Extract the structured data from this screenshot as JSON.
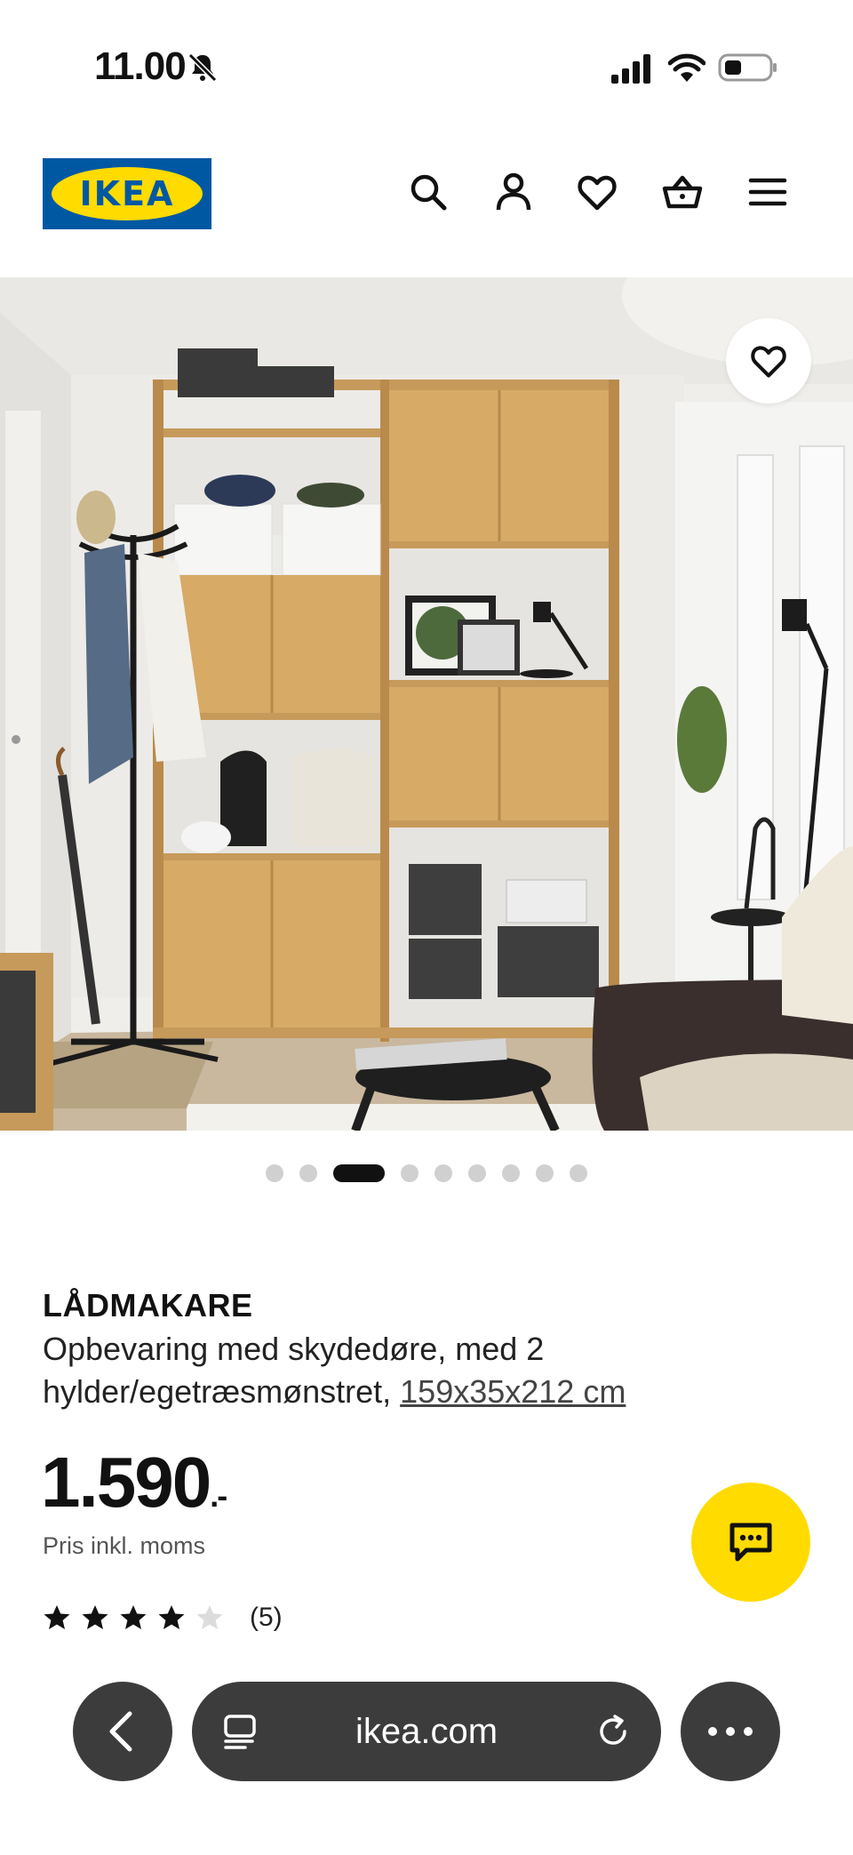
{
  "status_bar": {
    "time": "11.00"
  },
  "header": {
    "logo_text": "IKEA",
    "icons": [
      "search-icon",
      "user-icon",
      "heart-icon",
      "basket-icon",
      "menu-icon"
    ]
  },
  "gallery": {
    "total_images": 9,
    "active_index": 3
  },
  "product": {
    "name": "LÅDMAKARE",
    "description": "Opbevaring med skydedøre, med 2 hylder/egetræsmønstret,",
    "dimensions": "159x35x212 cm",
    "price": "1.590",
    "price_suffix": ".-",
    "price_note": "Pris inkl. moms",
    "rating": 4,
    "rating_max": 5,
    "review_count": "(5)"
  },
  "browser": {
    "url": "ikea.com"
  },
  "colors": {
    "brand_blue": "#0058a3",
    "brand_yellow": "#ffdb00",
    "browser_dark": "#3c3c3c"
  }
}
